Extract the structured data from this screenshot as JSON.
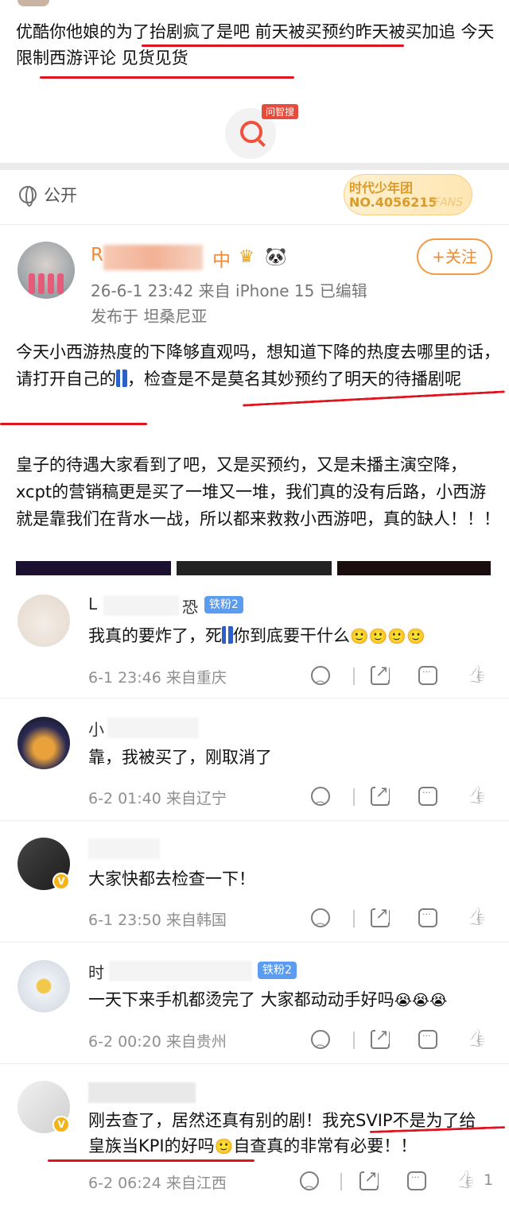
{
  "top_post": {
    "text": "优酷你他娘的为了抬剧疯了是吧 前天被买预约昨天被买加追 今天限制西游评论 见货见货",
    "wenzhi_badge": "问智搜"
  },
  "visibility": {
    "label": "公开"
  },
  "fans_badge": {
    "line1": "时代少年团",
    "line2": "NO.4056215",
    "watermark": "FANS"
  },
  "main_post": {
    "name_start": "R",
    "name_end": "中",
    "follow_label": "+关注",
    "meta": "26-6-1 23:42  来自 iPhone 15  已编辑",
    "location": "发布于 坦桑尼亚",
    "p1_a": "今天小西游热度的下降够直观吗，想知道下降的热度去哪里的话，请打开自己的",
    "p1_b": "，检查是不是莫名其妙预约了明天的待播剧呢",
    "p2": "皇子的待遇大家看到了吧，又是买预约，又是未播主演空降，xcpt的营销稿更是买了一堆又一堆，我们真的没有后路，小西游就是靠我们在背水一战，所以都来救救小西游吧，真的缺人！！！"
  },
  "comments": [
    {
      "name_a": "L",
      "name_b": "恐",
      "fan_badge": "铁粉2",
      "text_a": "我真的要炸了，死",
      "text_b": "你到底要干什么",
      "emoji": "🙂🙂🙂🙂",
      "meta": "6-1 23:46  来自重庆",
      "likes": ""
    },
    {
      "name_a": "小",
      "name_b": "",
      "text": "靠，我被买了，刚取消了",
      "meta": "6-2 01:40  来自辽宁",
      "likes": ""
    },
    {
      "name_a": "",
      "name_b": "",
      "text": "大家快都去检查一下！",
      "meta": "6-1 23:50  来自韩国",
      "likes": ""
    },
    {
      "name_a": "时",
      "name_b": "",
      "fan_badge": "铁粉2",
      "text": "一天下来手机都烫完了 大家都动动手好吗",
      "emoji": "😭😭😭",
      "meta": "6-2 00:20  来自贵州",
      "likes": ""
    },
    {
      "name_a": "",
      "name_b": "",
      "text_a": "刚去查了，居然还真有别的剧！我充SVIP不是为了给皇族当KPI的好吗",
      "emoji": "🙂",
      "text_b": "自查真的非常有必要！！",
      "meta": "6-2 06:24  来自江西",
      "likes": "1"
    }
  ],
  "colors": {
    "accent_red": "#e0141e",
    "follow_orange": "#f08a2b",
    "fan_badge_blue": "#5c9cf0"
  }
}
